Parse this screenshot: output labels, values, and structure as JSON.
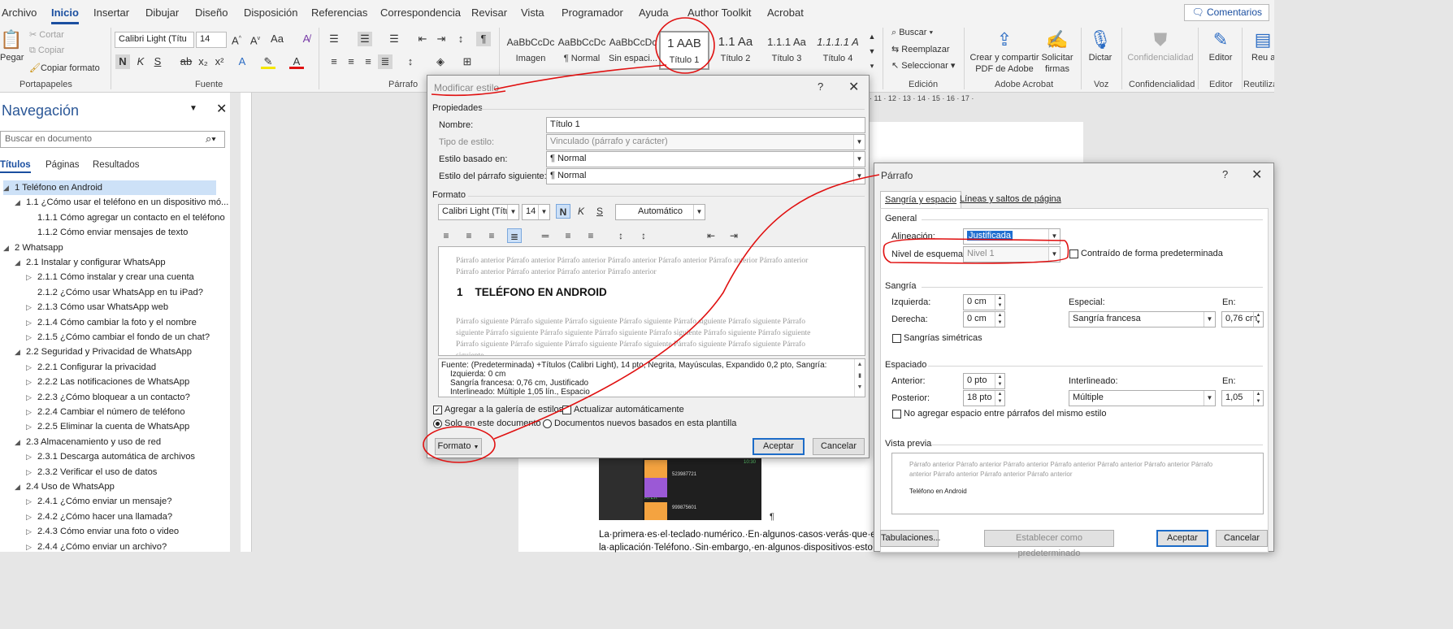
{
  "menu": {
    "tabs": [
      "Archivo",
      "Inicio",
      "Insertar",
      "Dibujar",
      "Diseño",
      "Disposición",
      "Referencias",
      "Correspondencia",
      "Revisar",
      "Vista",
      "Programador",
      "Ayuda",
      "Author Toolkit",
      "Acrobat"
    ],
    "comments": "Comentarios"
  },
  "ribbon": {
    "clipboard": {
      "paste": "Pegar",
      "cut": "Cortar",
      "copy": "Copiar",
      "format_painter": "Copiar formato",
      "label": "Portapapeles"
    },
    "font": {
      "name": "Calibri Light (Títu",
      "size": "14",
      "label": "Fuente"
    },
    "paragraph": {
      "label": "Párrafo"
    },
    "styles": [
      {
        "sample": "AaBbCcDc",
        "name": "Imagen"
      },
      {
        "sample": "AaBbCcDc",
        "name": "¶ Normal"
      },
      {
        "sample": "AaBbCcDc",
        "name": "Sin espaci..."
      },
      {
        "sample": "1 AAB",
        "name": "Título 1"
      },
      {
        "sample": "1.1 Aa",
        "name": "Título 2"
      },
      {
        "sample": "1.1.1 Aa",
        "name": "Título 3"
      },
      {
        "sample": "1.1.1.1 A",
        "name": "Título 4"
      }
    ],
    "editing": {
      "find": "Buscar",
      "replace": "Reemplazar",
      "select": "Seleccionar",
      "label": "Edición"
    },
    "adobe": {
      "create_share": "Crear y compartir PDF de Adobe",
      "request": "Solicitar firmas",
      "label": "Adobe Acrobat"
    },
    "voice": {
      "dictate": "Dictar",
      "label": "Voz"
    },
    "sensitivity": {
      "btn": "Confidencialidad",
      "label": "Confidencialidad"
    },
    "editor": {
      "btn": "Editor",
      "label": "Editor"
    },
    "reuse": {
      "btn": "Reu arch",
      "label": "Reutiliza"
    }
  },
  "nav": {
    "title": "Navegación",
    "search_placeholder": "Buscar en documento",
    "tabs": [
      "Títulos",
      "Páginas",
      "Resultados"
    ],
    "items": [
      {
        "text": "1 Teléfono en Android",
        "lvl": 0,
        "tri": "◢",
        "sel": true
      },
      {
        "text": "1.1 ¿Cómo usar el teléfono en un dispositivo mó...",
        "lvl": 1,
        "tri": "◢"
      },
      {
        "text": "1.1.1 Cómo agregar un contacto en el teléfono",
        "lvl": 2,
        "tri": ""
      },
      {
        "text": "1.1.2 Cómo enviar mensajes de texto",
        "lvl": 2,
        "tri": ""
      },
      {
        "text": "2 Whatsapp",
        "lvl": 0,
        "tri": "◢"
      },
      {
        "text": "2.1 Instalar y configurar WhatsApp",
        "lvl": 1,
        "tri": "◢"
      },
      {
        "text": "2.1.1 Cómo instalar y crear una cuenta",
        "lvl": 2,
        "tri": "▷"
      },
      {
        "text": "2.1.2 ¿Cómo usar WhatsApp en tu iPad?",
        "lvl": 2,
        "tri": ""
      },
      {
        "text": "2.1.3 Cómo usar WhatsApp web",
        "lvl": 2,
        "tri": "▷"
      },
      {
        "text": "2.1.4 Cómo cambiar la foto y el nombre",
        "lvl": 2,
        "tri": "▷"
      },
      {
        "text": "2.1.5 ¿Cómo cambiar el fondo de un chat?",
        "lvl": 2,
        "tri": "▷"
      },
      {
        "text": "2.2 Seguridad y Privacidad de WhatsApp",
        "lvl": 1,
        "tri": "◢"
      },
      {
        "text": "2.2.1 Configurar la privacidad",
        "lvl": 2,
        "tri": "▷"
      },
      {
        "text": "2.2.2 Las notificaciones de WhatsApp",
        "lvl": 2,
        "tri": "▷"
      },
      {
        "text": "2.2.3 ¿Cómo bloquear a un contacto?",
        "lvl": 2,
        "tri": "▷"
      },
      {
        "text": "2.2.4 Cambiar el número de teléfono",
        "lvl": 2,
        "tri": "▷"
      },
      {
        "text": "2.2.5 Eliminar la cuenta de WhatsApp",
        "lvl": 2,
        "tri": "▷"
      },
      {
        "text": "2.3 Almacenamiento y uso de red",
        "lvl": 1,
        "tri": "◢"
      },
      {
        "text": "2.3.1 Descarga automática de archivos",
        "lvl": 2,
        "tri": "▷"
      },
      {
        "text": "2.3.2 Verificar el uso de datos",
        "lvl": 2,
        "tri": "▷"
      },
      {
        "text": "2.4 Uso de WhatsApp",
        "lvl": 1,
        "tri": "◢"
      },
      {
        "text": "2.4.1 ¿Cómo enviar un mensaje?",
        "lvl": 2,
        "tri": "▷"
      },
      {
        "text": "2.4.2 ¿Cómo hacer una llamada?",
        "lvl": 2,
        "tri": "▷"
      },
      {
        "text": "2.4.3 Cómo enviar una foto o video",
        "lvl": 2,
        "tri": "▷"
      },
      {
        "text": "2.4.4 ¿Cómo enviar un archivo?",
        "lvl": 2,
        "tri": "▷"
      }
    ]
  },
  "ruler_h": "· 11 · 12 · 13 · 14 · 15 · 16 · 17 ·",
  "doc": {
    "line1": "La·primera·es·el·teclado·numérico.·En·algunos·casos·verás·que·el·t",
    "line2": "la·aplicación·Teléfono.·Sin·embargo,·en·algunos·dispositivos·esto",
    "phone": [
      "10:30",
      "523987721",
      "AYER",
      "999875601"
    ],
    "pilcrow": "¶"
  },
  "modify": {
    "title": "Modificar estilo",
    "props": "Propiedades",
    "name_lbl": "Nombre:",
    "name_val": "Título 1",
    "type_lbl": "Tipo de estilo:",
    "type_val": "Vinculado (párrafo y carácter)",
    "based_lbl": "Estilo basado en:",
    "based_val": "¶  Normal",
    "next_lbl": "Estilo del párrafo siguiente:",
    "next_val": "¶  Normal",
    "format": "Formato",
    "font": "Calibri Light (Título",
    "size": "14",
    "color": "Automático",
    "prev_before": "Párrafo anterior Párrafo anterior Párrafo anterior Párrafo anterior Párrafo anterior Párrafo anterior Párrafo anterior Párrafo anterior Párrafo anterior Párrafo anterior Párrafo anterior",
    "heading": "1    TELÉFONO EN ANDROID",
    "prev_after": "Párrafo siguiente Párrafo siguiente Párrafo siguiente Párrafo siguiente Párrafo siguiente Párrafo siguiente Párrafo siguiente Párrafo siguiente Párrafo siguiente Párrafo siguiente Párrafo siguiente Párrafo siguiente Párrafo siguiente Párrafo siguiente Párrafo siguiente Párrafo siguiente Párrafo siguiente Párrafo siguiente Párrafo siguiente Párrafo siguiente",
    "desc1": "Fuente: (Predeterminada) +Títulos (Calibri Light), 14 pto, Negrita, Mayúsculas, Expandido  0,2 pto, Sangría:",
    "desc2": "Izquierda:  0 cm",
    "desc3": "Sangría francesa:  0,76 cm, Justificado",
    "desc4": "Interlineado:  Múltiple 1,05 lín., Espacio",
    "add_gallery": "Agregar a la galería de estilos",
    "auto_update": "Actualizar automáticamente",
    "only_doc": "Solo en este documento",
    "new_docs": "Documentos nuevos basados en esta plantilla",
    "format_btn": "Formato",
    "ok": "Aceptar",
    "cancel": "Cancelar"
  },
  "para": {
    "title": "Párrafo",
    "tab1": "Sangría y espacio",
    "tab2": "Líneas y saltos de página",
    "general": "General",
    "align_lbl": "Alineación:",
    "align_val": "Justificada",
    "outline_lbl": "Nivel de esquema:",
    "outline_val": "Nivel 1",
    "collapsed": "Contraído de forma predeterminada",
    "indent": "Sangría",
    "left_lbl": "Izquierda:",
    "left_val": "0 cm",
    "right_lbl": "Derecha:",
    "right_val": "0 cm",
    "special_lbl": "Especial:",
    "special_val": "Sangría francesa",
    "by_lbl": "En:",
    "by_val": "0,76 cm",
    "mirror": "Sangrías simétricas",
    "spacing": "Espaciado",
    "before_lbl": "Anterior:",
    "before_val": "0 pto",
    "after_lbl": "Posterior:",
    "after_val": "18 pto",
    "line_lbl": "Interlineado:",
    "line_val": "Múltiple",
    "at_lbl": "En:",
    "at_val": "1,05",
    "no_space": "No agregar espacio entre párrafos del mismo estilo",
    "preview": "Vista previa",
    "prev_text": "Párrafo anterior Párrafo anterior Párrafo anterior Párrafo anterior Párrafo anterior Párrafo anterior Párrafo anterior Párrafo anterior Párrafo anterior Párrafo anterior",
    "prev_heading": "Teléfono en Android",
    "tabs_btn": "Tabulaciones...",
    "default_btn": "Establecer como predeterminado",
    "ok": "Aceptar",
    "cancel": "Cancelar"
  },
  "colors": {
    "accent": "#1b4fa0",
    "annotation": "#e01010"
  }
}
